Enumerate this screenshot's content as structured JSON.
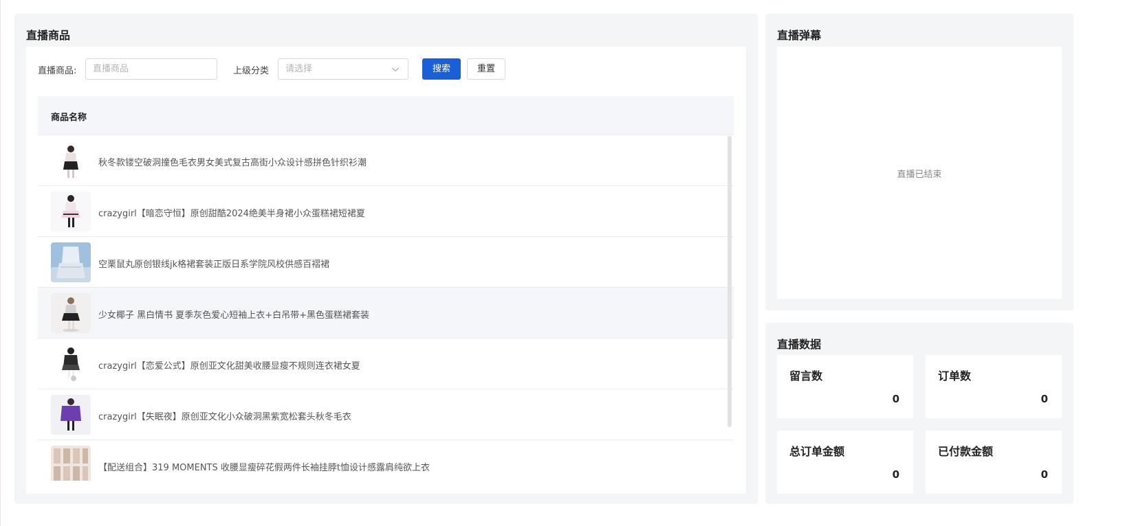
{
  "goods_panel": {
    "title": "直播商品",
    "filter": {
      "goods_label": "直播商品:",
      "goods_placeholder": "直播商品",
      "category_label": "上级分类",
      "category_placeholder": "请选择",
      "search_label": "搜索",
      "reset_label": "重置"
    },
    "table": {
      "column_name": "商品名称",
      "rows": [
        {
          "name": "秋冬款镂空破洞撞色毛衣男女美式复古高街小众设计感拼色针织衫潮"
        },
        {
          "name": "crazygirl【暗恋守恒】原创甜酷2024绝美半身裙小众蛋糕裙短裙夏"
        },
        {
          "name": "空栗鼠丸原创银线jk格裙套装正版日系学院风校供感百褶裙"
        },
        {
          "name": "少女椰子 黑白情书 夏季灰色爱心短袖上衣+白吊带+黑色蛋糕裙套装"
        },
        {
          "name": "crazygirl【恋爱公式】原创亚文化甜美收腰显瘦不规则连衣裙女夏"
        },
        {
          "name": "crazygirl【失眠夜】原创亚文化小众破洞黑紫宽松套头秋冬毛衣"
        },
        {
          "name": "【配送组合】319 MOMENTS 收腰显瘦碎花假两件长袖挂脖t恤设计感露肩纯欲上衣"
        }
      ]
    }
  },
  "danmu_panel": {
    "title": "直播弹幕",
    "empty_text": "直播已结束"
  },
  "stats_panel": {
    "title": "直播数据",
    "cards": [
      {
        "label": "留言数",
        "value": "0"
      },
      {
        "label": "订单数",
        "value": "0"
      },
      {
        "label": "总订单金额",
        "value": "0"
      },
      {
        "label": "已付款金额",
        "value": "0"
      }
    ]
  },
  "colors": {
    "primary": "#1a5fd6",
    "panel_bg": "#f4f5f7",
    "row_hover": "#f5f6f9"
  }
}
